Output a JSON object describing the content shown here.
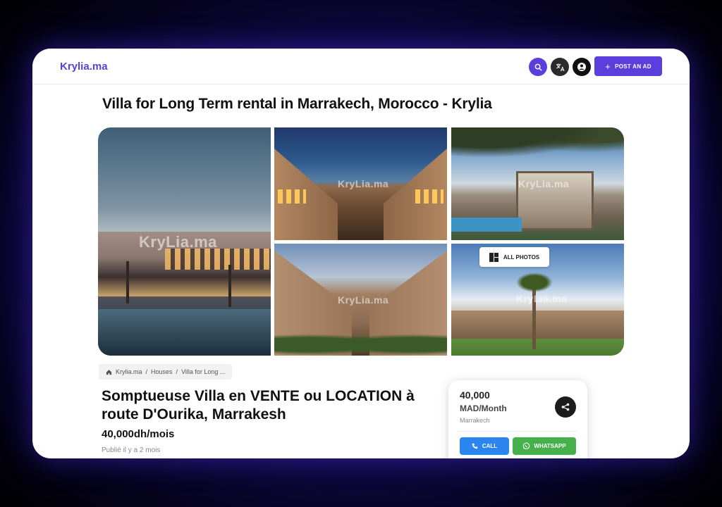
{
  "header": {
    "logo": "Krylia.ma",
    "post_ad_label": "POST AN AD",
    "post_ad_icon": "plus-icon",
    "search_icon": "search-icon",
    "language_icon": "translate-icon",
    "account_icon": "account-icon"
  },
  "page": {
    "title": "Villa for Long Term rental in Marrakech, Morocco - Krylia"
  },
  "gallery": {
    "watermark": "KryLia.ma",
    "all_photos_label": "ALL PHOTOS",
    "all_photos_icon": "gallery-grid-icon"
  },
  "breadcrumb": {
    "items": [
      "Krylia.ma",
      "Houses",
      "Villa for Long ..."
    ],
    "separator": "/"
  },
  "listing": {
    "title": "Somptueuse Villa en VENTE ou LOCATION à route D'Ourika, Marrakesh",
    "price": "40,000dh/mois",
    "published": "Publié il y a 2 mois"
  },
  "price_card": {
    "amount": "40,000",
    "period": "MAD/Month",
    "city": "Marrakech",
    "call_label": "CALL",
    "whatsapp_label": "WHATSAPP",
    "call_color": "#2a86ee",
    "whatsapp_color": "#45b14a"
  },
  "colors": {
    "brand": "#5b3fdc"
  }
}
